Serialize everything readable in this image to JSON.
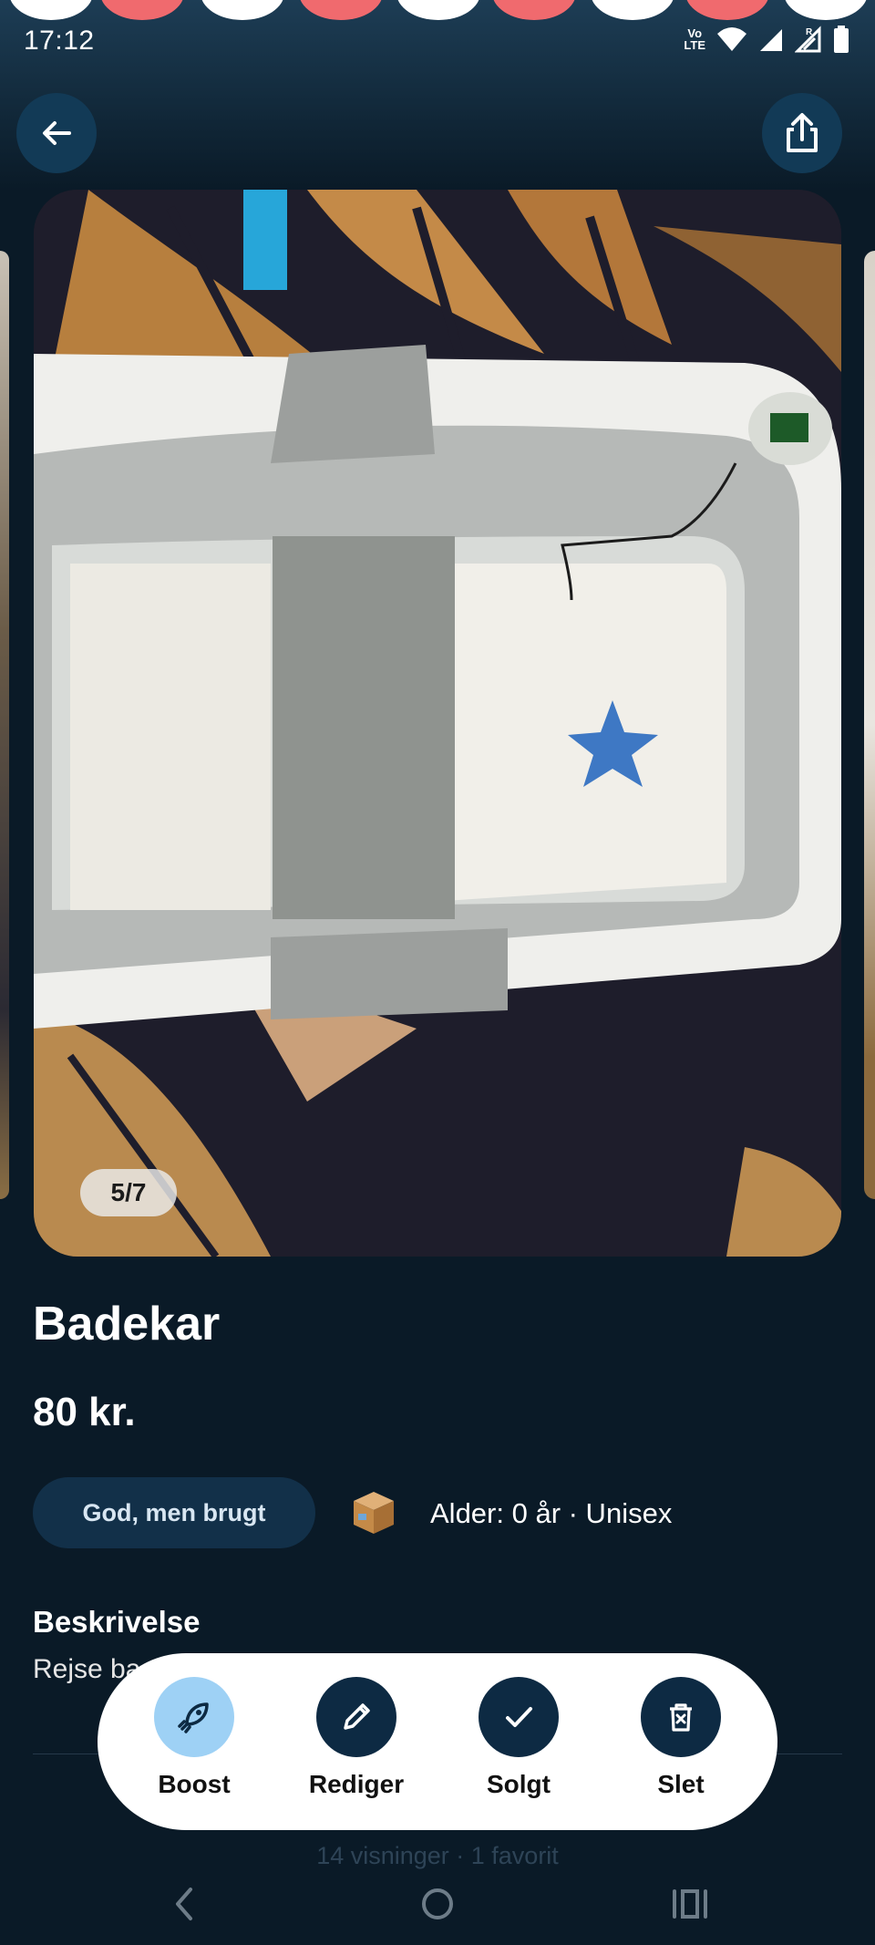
{
  "status_bar": {
    "time": "17:12",
    "network_label": "Vo LTE",
    "icons": [
      "volte-icon",
      "wifi-icon",
      "signal-icon",
      "roaming-signal-icon",
      "battery-icon"
    ]
  },
  "header": {
    "back_icon": "arrow-left-icon",
    "share_icon": "share-icon"
  },
  "gallery": {
    "counter": "5/7"
  },
  "listing": {
    "title": "Badekar",
    "price": "80 kr.",
    "condition": "God, men brugt",
    "meta_icon": "package-box-icon",
    "meta": "Alder: 0 år · Unisex",
    "description_heading": "Beskrivelse",
    "description_visible": "Rejse ba",
    "stats": "14 visninger · 1 favorit"
  },
  "actions": [
    {
      "label": "Boost",
      "icon": "rocket-icon"
    },
    {
      "label": "Rediger",
      "icon": "pencil-icon"
    },
    {
      "label": "Solgt",
      "icon": "check-icon"
    },
    {
      "label": "Slet",
      "icon": "trash-icon"
    }
  ],
  "colors": {
    "background": "#0a1a27",
    "button_dark": "#0d2a43",
    "boost_accent": "#9ed1f5",
    "condition_chip": "#123049",
    "notification_red": "#f06a6e"
  },
  "system_nav": {
    "icons": [
      "back-nav-icon",
      "home-nav-icon",
      "recents-nav-icon"
    ]
  }
}
